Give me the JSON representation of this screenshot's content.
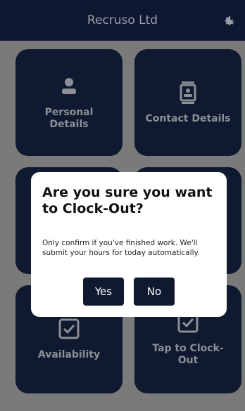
{
  "header": {
    "title": "Recruso Ltd",
    "settings_icon": "gear-icon"
  },
  "tiles": [
    {
      "label": "Personal\nDetails",
      "icon": "person-icon"
    },
    {
      "label": "Contact Details",
      "icon": "contact-card-icon"
    },
    {
      "label": "Availability",
      "icon": "checkbox-icon"
    },
    {
      "label": "Tap to Clock-\nOut",
      "icon": "checkbox-icon"
    }
  ],
  "dialog": {
    "title": "Are you sure you want to Clock-Out?",
    "message": "Only confirm if you've finished work. We'll submit your hours for today automatically.",
    "yes_label": "Yes",
    "no_label": "No"
  },
  "colors": {
    "header": "#0d1830",
    "tile": "#0f1a30",
    "background": "#7a7a7a",
    "button": "#0f1a30"
  }
}
